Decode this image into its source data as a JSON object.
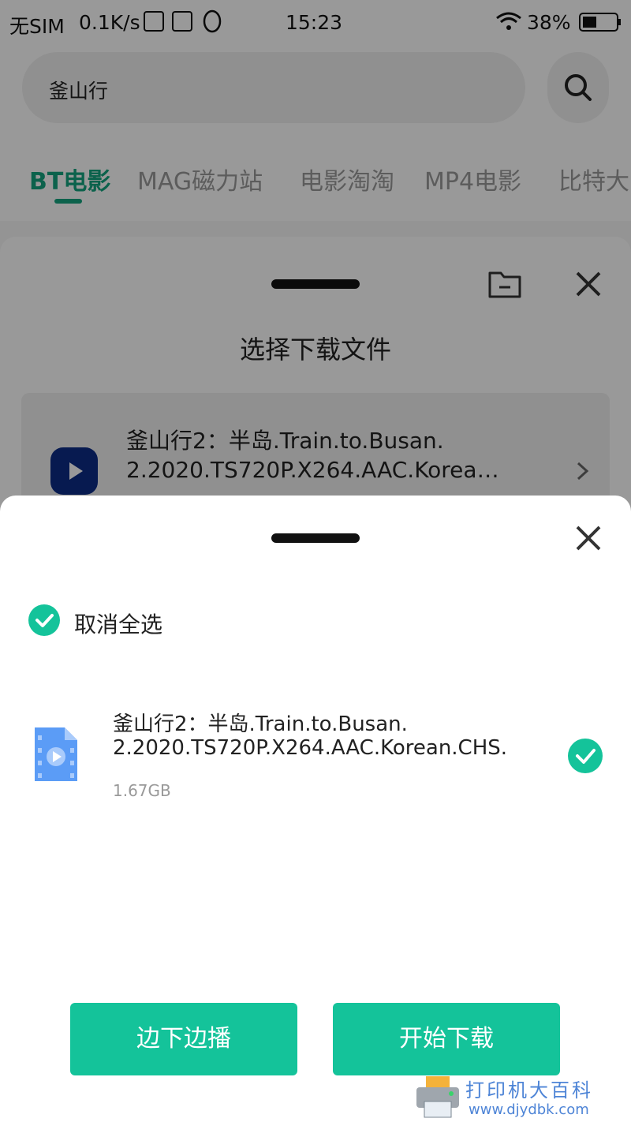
{
  "status_bar": {
    "carrier": "无SIM",
    "speed": "0.1K/s",
    "time": "15:23",
    "battery": "38%"
  },
  "search": {
    "query": "釜山行"
  },
  "tabs": [
    "BT电影",
    "MAG磁力站",
    "电影淘淘",
    "MP4电影",
    "比特大"
  ],
  "file_sheet": {
    "title": "选择下载文件",
    "item_line1": "釜山行2：半岛.Train.to.Busan.",
    "item_line2": "2.2020.TS720P.X264.AAC.Korea…"
  },
  "download_sheet": {
    "select_all_label": "取消全选",
    "file": {
      "name_line1": "釜山行2：半岛.Train.to.Busan.",
      "name_line2": "2.2020.TS720P.X264.AAC.Korean.CHS.",
      "size": "1.67GB"
    },
    "play_while_download_label": "边下边播",
    "start_download_label": "开始下载"
  },
  "watermark": {
    "text": "打印机大百科",
    "url": "www.djydbk.com"
  },
  "colors": {
    "accent": "#14c39a",
    "tab_active": "#14a37f"
  }
}
